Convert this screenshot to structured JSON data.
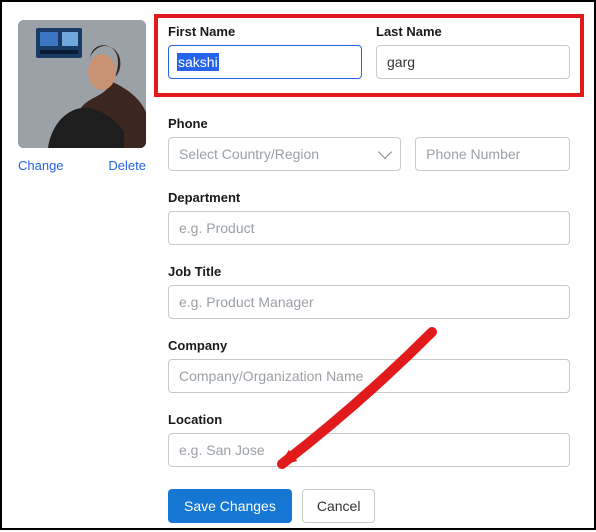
{
  "avatar": {
    "change_label": "Change",
    "delete_label": "Delete"
  },
  "first_name": {
    "label": "First Name",
    "value": "sakshi"
  },
  "last_name": {
    "label": "Last Name",
    "value": "garg"
  },
  "phone": {
    "label": "Phone",
    "country_placeholder": "Select Country/Region",
    "number_placeholder": "Phone Number"
  },
  "department": {
    "label": "Department",
    "placeholder": "e.g. Product"
  },
  "job_title": {
    "label": "Job Title",
    "placeholder": "e.g. Product Manager"
  },
  "company": {
    "label": "Company",
    "placeholder": "Company/Organization Name"
  },
  "location": {
    "label": "Location",
    "placeholder": "e.g. San Jose"
  },
  "buttons": {
    "save": "Save Changes",
    "cancel": "Cancel"
  },
  "highlight_color": "#e11b1b",
  "annotation_arrow_color": "#e11b1b"
}
